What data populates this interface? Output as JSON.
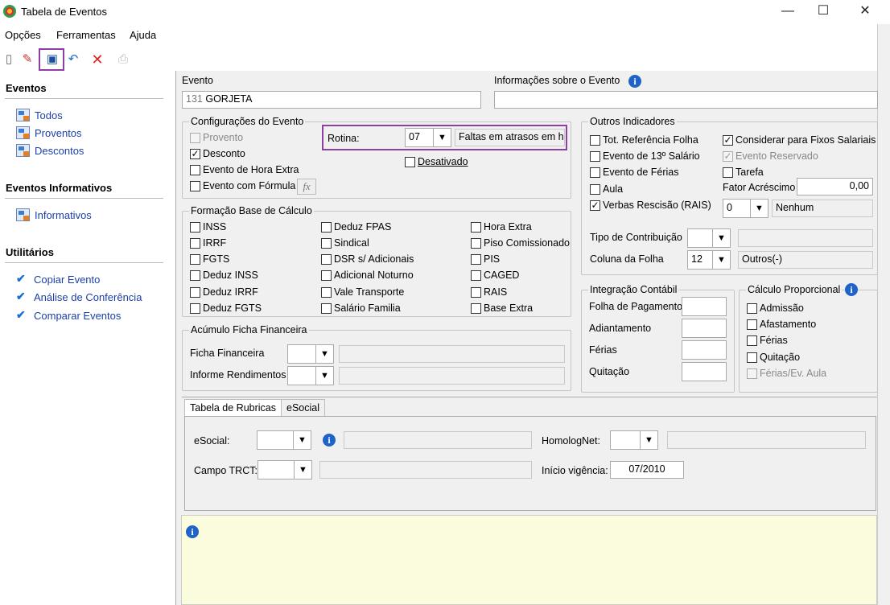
{
  "window": {
    "title": "Tabela de Eventos",
    "minimize": "—",
    "maximize": "☐",
    "close": "✕"
  },
  "menu": [
    "Opções",
    "Ferramentas",
    "Ajuda"
  ],
  "sidebar": {
    "eventos_title": "Eventos",
    "eventos": [
      "Todos",
      "Proventos",
      "Descontos"
    ],
    "informativos_title": "Eventos Informativos",
    "informativos": [
      "Informativos"
    ],
    "utilitarios_title": "Utilitários",
    "utilitarios": [
      "Copiar Evento",
      "Análise de Conferência",
      "Comparar Eventos"
    ]
  },
  "evento": {
    "label": "Evento",
    "code": "131",
    "name": "GORJETA",
    "info_label": "Informações sobre o Evento",
    "info_value": ""
  },
  "config": {
    "title": "Configurações do Evento",
    "provento": "Provento",
    "desconto": "Desconto",
    "hora_extra": "Evento de Hora Extra",
    "com_formula": "Evento com Fórmula",
    "fx": "fx",
    "rotina_label": "Rotina:",
    "rotina_code": "07",
    "rotina_desc": "Faltas em atrasos em ho",
    "desativado": "Desativado"
  },
  "base": {
    "title": "Formação Base de Cálculo",
    "col1": [
      "INSS",
      "IRRF",
      "FGTS",
      "Deduz INSS",
      "Deduz IRRF",
      "Deduz FGTS"
    ],
    "col2": [
      "Deduz FPAS",
      "Sindical",
      "DSR s/ Adicionais",
      "Adicional Noturno",
      "Vale Transporte",
      "Salário Familia"
    ],
    "col3": [
      "Hora Extra",
      "Piso Comissionado",
      "PIS",
      "CAGED",
      "RAIS",
      "Base Extra"
    ]
  },
  "acumulo": {
    "title": "Acúmulo Ficha Financeira",
    "ficha": "Ficha Financeira",
    "informe": "Informe Rendimentos"
  },
  "outros": {
    "title": "Outros Indicadores",
    "tot_ref": "Tot. Referência Folha",
    "decimo": "Evento de 13º Salário",
    "ferias": "Evento de Férias",
    "aula": "Aula",
    "verbas": "Verbas Rescisão (RAIS)",
    "fixos": "Considerar para Fixos Salariais",
    "reservado": "Evento Reservado",
    "tarefa": "Tarefa",
    "fator_label": "Fator Acréscimo",
    "fator_value": "0,00",
    "rais_code": "0",
    "rais_desc": "Nenhum",
    "tipo_label": "Tipo de Contribuição",
    "coluna_label": "Coluna da Folha",
    "coluna_code": "12",
    "coluna_desc": "Outros(-)"
  },
  "integracao": {
    "title": "Integração Contábil",
    "items": [
      "Folha de Pagamento",
      "Adiantamento",
      "Férias",
      "Quitação"
    ]
  },
  "proporcional": {
    "title": "Cálculo Proporcional",
    "items": [
      "Admissão",
      "Afastamento",
      "Férias",
      "Quitação",
      "Férias/Ev. Aula"
    ]
  },
  "tabs": [
    "Tabela de Rubricas",
    "eSocial"
  ],
  "rubricas": {
    "esocial_label": "eSocial:",
    "homolog_label": "HomologNet:",
    "trct_label": "Campo TRCT:",
    "inicio_label": "Início vigência:",
    "inicio_value": "07/2010"
  },
  "icons": {
    "info": "i",
    "dropdown": "▼"
  }
}
